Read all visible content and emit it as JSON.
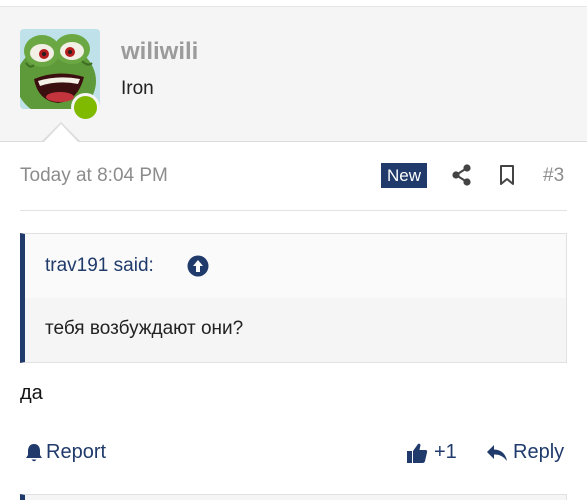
{
  "user": {
    "username": "wiliwili",
    "title": "Iron",
    "online": true,
    "avatar_icon": "frog-avatar",
    "online_color": "#7fb900"
  },
  "post": {
    "date": "Today at 8:04 PM",
    "badge": "New",
    "number": "#3",
    "share_icon": "share-icon",
    "bookmark_icon": "bookmark-icon",
    "body": "да"
  },
  "quote": {
    "author_label": "trav191 said:",
    "jump_icon": "arrow-up-circle-icon",
    "text": "тебя возбуждают они?"
  },
  "actions": {
    "report_label": "Report",
    "like_count": "+1",
    "reply_label": "Reply"
  },
  "colors": {
    "accent": "#1f3a6b",
    "muted_text": "#8c8c8c",
    "panel_bg": "#f5f5f5"
  }
}
